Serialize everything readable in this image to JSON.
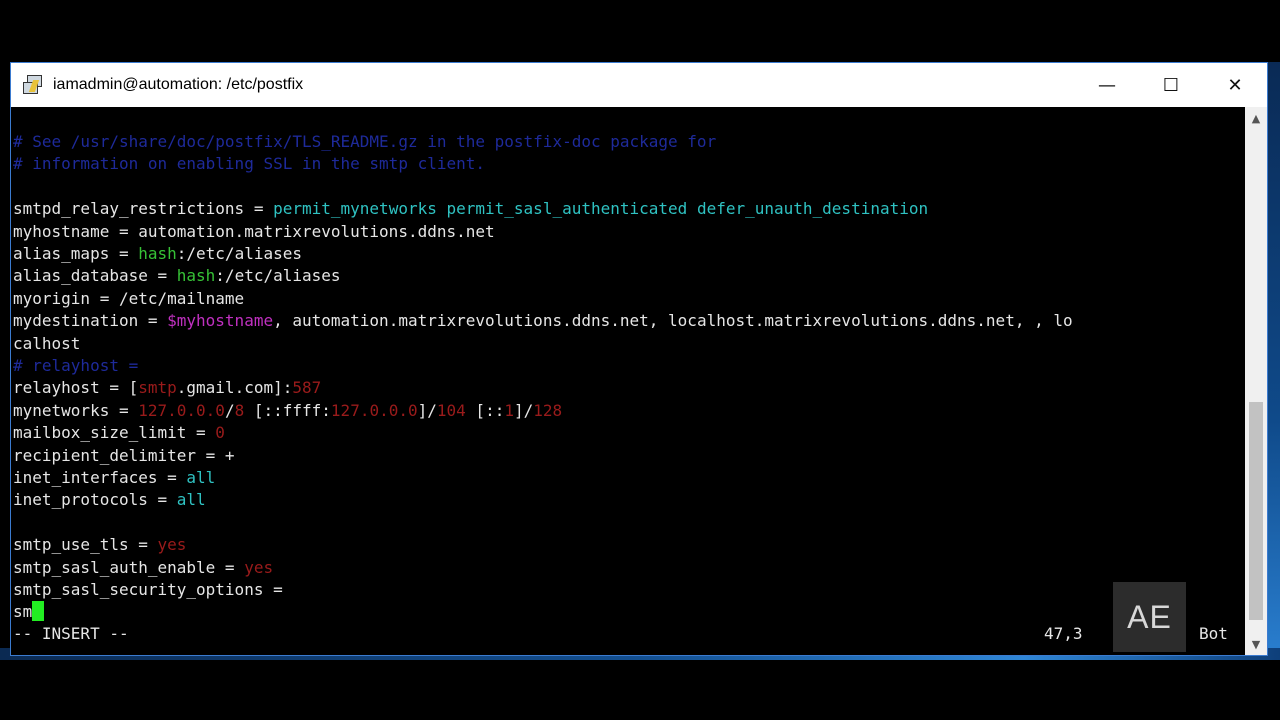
{
  "window": {
    "title": "iamadmin@automation: /etc/postfix",
    "controls": {
      "minimize": "—",
      "maximize": "☐",
      "close": "✕"
    }
  },
  "terminal": {
    "lines": [
      [
        {
          "t": "# See /usr/share/doc/postfix/TLS_README.gz in the postfix-doc package for",
          "c": "c-comment"
        }
      ],
      [
        {
          "t": "# information on enabling SSL in the smtp client.",
          "c": "c-comment"
        }
      ],
      [],
      [
        {
          "t": "smtpd_relay_restrictions = ",
          "c": "c-key"
        },
        {
          "t": "permit_mynetworks permit_sasl_authenticated defer_unauth_destination",
          "c": "c-cyan"
        }
      ],
      [
        {
          "t": "myhostname = automation.matrixrevolutions.ddns.net",
          "c": "c-key"
        }
      ],
      [
        {
          "t": "alias_maps = ",
          "c": "c-key"
        },
        {
          "t": "hash",
          "c": "c-green"
        },
        {
          "t": ":/etc/aliases",
          "c": "c-key"
        }
      ],
      [
        {
          "t": "alias_database = ",
          "c": "c-key"
        },
        {
          "t": "hash",
          "c": "c-green"
        },
        {
          "t": ":/etc/aliases",
          "c": "c-key"
        }
      ],
      [
        {
          "t": "myorigin = /etc/mailname",
          "c": "c-key"
        }
      ],
      [
        {
          "t": "mydestination = ",
          "c": "c-key"
        },
        {
          "t": "$myhostname",
          "c": "c-mag"
        },
        {
          "t": ", automation.matrixrevolutions.ddns.net, localhost.matrixrevolutions.ddns.net, , lo",
          "c": "c-key"
        }
      ],
      [
        {
          "t": "calhost",
          "c": "c-key"
        }
      ],
      [
        {
          "t": "# relayhost =",
          "c": "c-comment"
        }
      ],
      [
        {
          "t": "relayhost = [",
          "c": "c-key"
        },
        {
          "t": "smtp",
          "c": "c-red"
        },
        {
          "t": ".gmail.com]:",
          "c": "c-key"
        },
        {
          "t": "587",
          "c": "c-red"
        }
      ],
      [
        {
          "t": "mynetworks = ",
          "c": "c-key"
        },
        {
          "t": "127.0.0.0",
          "c": "c-red"
        },
        {
          "t": "/",
          "c": "c-key"
        },
        {
          "t": "8",
          "c": "c-red"
        },
        {
          "t": " [::ffff:",
          "c": "c-key"
        },
        {
          "t": "127.0.0.0",
          "c": "c-red"
        },
        {
          "t": "]/",
          "c": "c-key"
        },
        {
          "t": "104",
          "c": "c-red"
        },
        {
          "t": " [::",
          "c": "c-key"
        },
        {
          "t": "1",
          "c": "c-red"
        },
        {
          "t": "]/",
          "c": "c-key"
        },
        {
          "t": "128",
          "c": "c-red"
        }
      ],
      [
        {
          "t": "mailbox_size_limit = ",
          "c": "c-key"
        },
        {
          "t": "0",
          "c": "c-red"
        }
      ],
      [
        {
          "t": "recipient_delimiter = +",
          "c": "c-key"
        }
      ],
      [
        {
          "t": "inet_interfaces = ",
          "c": "c-key"
        },
        {
          "t": "all",
          "c": "c-cyan"
        }
      ],
      [
        {
          "t": "inet_protocols = ",
          "c": "c-key"
        },
        {
          "t": "all",
          "c": "c-cyan"
        }
      ],
      [],
      [
        {
          "t": "smtp_use_tls = ",
          "c": "c-key"
        },
        {
          "t": "yes",
          "c": "c-red"
        }
      ],
      [
        {
          "t": "smtp_sasl_auth_enable = ",
          "c": "c-key"
        },
        {
          "t": "yes",
          "c": "c-red"
        }
      ],
      [
        {
          "t": "smtp_sasl_security_options =",
          "c": "c-key"
        }
      ],
      [
        {
          "t": "sm",
          "c": "c-key"
        }
      ]
    ],
    "status": {
      "mode": "-- INSERT --",
      "position": "47,3",
      "scroll": "Bot"
    }
  },
  "watermark": "AE"
}
